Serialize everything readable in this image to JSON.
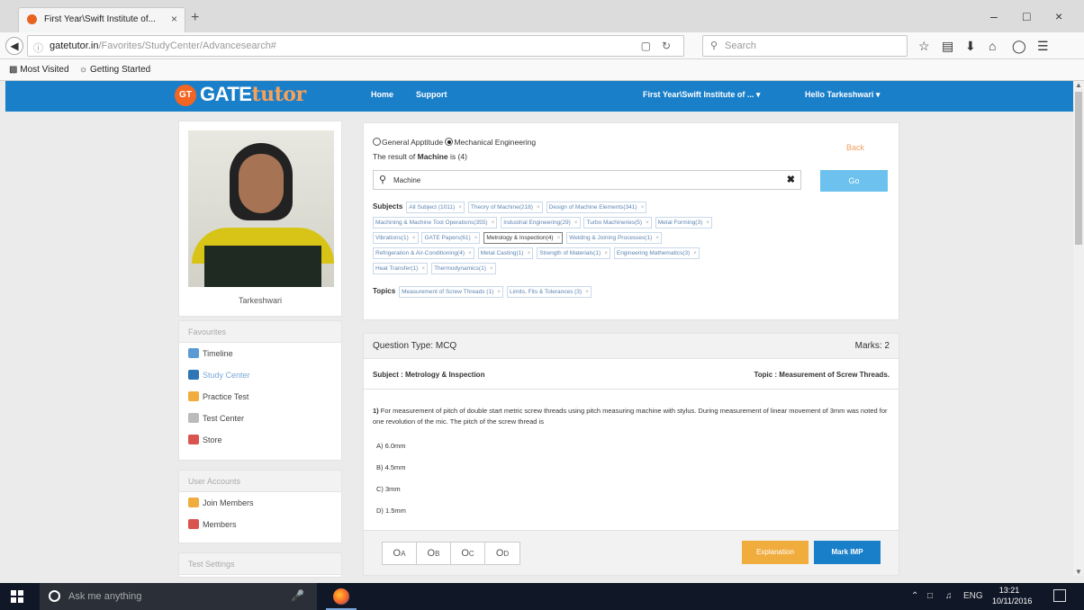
{
  "browser": {
    "tab_title": "First Year\\Swift Institute of...",
    "tab_close": "×",
    "new_tab": "+",
    "url_domain": "gatetutor.in",
    "url_path": "/Favorites/StudyCenter/Advancesearch#",
    "search_placeholder": "Search",
    "bookmarks": [
      "Most Visited",
      "Getting Started"
    ],
    "window_controls": [
      "–",
      "□",
      "×"
    ]
  },
  "site_header": {
    "logo_badge": "GT",
    "logo_main": "GATE",
    "logo_accent": "tutor",
    "nav": [
      "Home",
      "Support"
    ],
    "institute_menu": "First Year\\Swift Institute of ... ▾",
    "user_menu": "Hello Tarkeshwari ▾"
  },
  "profile": {
    "name": "Tarkeshwari"
  },
  "sidebar": {
    "favourites_heading": "Favourites",
    "favourites": [
      {
        "label": "Timeline",
        "icon": "timeline-icon",
        "color": "#5b9bd5"
      },
      {
        "label": "Study Center",
        "icon": "study-center-icon",
        "color": "#2e75b6"
      },
      {
        "label": "Practice Test",
        "icon": "practice-test-icon",
        "color": "#f0ad3e"
      },
      {
        "label": "Test Center",
        "icon": "test-center-icon",
        "color": "#bbbbbb"
      },
      {
        "label": "Store",
        "icon": "store-icon",
        "color": "#d9534f"
      }
    ],
    "user_accounts_heading": "User Accounts",
    "user_accounts": [
      {
        "label": "Join Members",
        "icon": "join-members-icon",
        "color": "#f0ad3e"
      },
      {
        "label": "Members",
        "icon": "members-icon",
        "color": "#d9534f"
      }
    ],
    "test_settings_heading": "Test Settings"
  },
  "search": {
    "radio_general": "General Apptitude",
    "radio_mechanical": "Mechanical Engineering",
    "back_label": "Back",
    "result_prefix": "The result of",
    "result_term": "Machine",
    "result_suffix": "is (4)",
    "query": "Machine",
    "clear_symbol": "✖",
    "go_label": "Go",
    "subjects_label": "Subjects",
    "subjects": [
      "All Subject (1011)",
      "Theory of Machine(218)",
      "Design of Machine Elements(341)",
      "Machining & Machine Tool Operations(355)",
      "Industrial Engineering(29)",
      "Turbo Machineries(5)",
      "Metal Forming(3)",
      "Vibrations(1)",
      "GATE Papers(61)",
      "Metrology & Inspection(4)",
      "Welding & Joining Processes(1)",
      "Refrigeration & Air-Conditioning(4)",
      "Metal Casting(1)",
      "Strength of Materials(1)",
      "Engineering Mathematics(3)",
      "Heat Transfer(1)",
      "Thermodynamics(1)"
    ],
    "selected_subject": "Metrology & Inspection(4)",
    "topics_label": "Topics",
    "topics": [
      "Measurement of Screw Threads (1)",
      "Limits, Fits & Tolerances (3)"
    ]
  },
  "question": {
    "type_label": "Question Type: MCQ",
    "marks_label": "Marks: 2",
    "subject_label": "Subject : Metrology & Inspection",
    "topic_label": "Topic : Measurement of Screw Threads.",
    "number": "1)",
    "text": "For measurement of pitch of double start metric screw threads using pitch measuring machine with stylus. During measurement of linear movement of 3mm was noted for one revolution of the mic. The pitch of the screw thread is",
    "options": [
      "A) 6.0mm",
      "B) 4.5mm",
      "C) 3mm",
      "D) 1.5mm"
    ],
    "answer_choices": [
      "A",
      "B",
      "C",
      "D"
    ],
    "explanation_label": "Explanation",
    "mark_label": "Mark IMP"
  },
  "taskbar": {
    "search_placeholder": "Ask me anything",
    "language": "ENG",
    "time": "13:21",
    "date": "10/11/2016"
  }
}
